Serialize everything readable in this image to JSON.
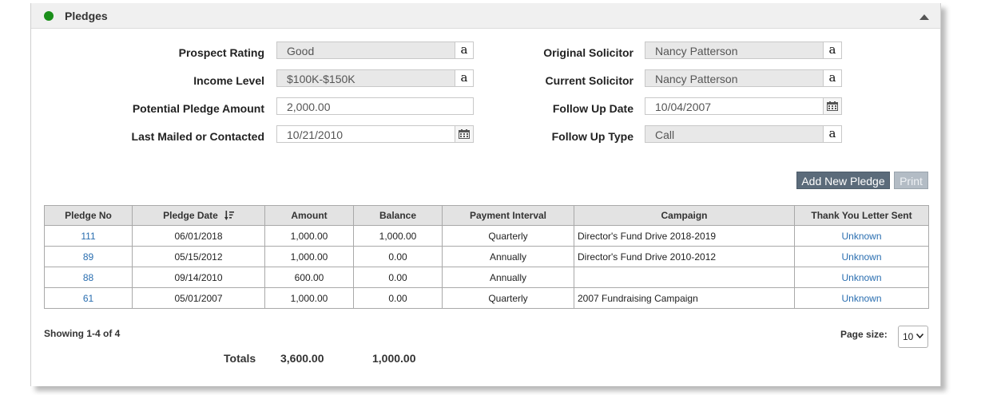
{
  "section": {
    "title": "Pledges",
    "status_color": "#1a8f1a"
  },
  "fields": {
    "prospect_rating": {
      "label": "Prospect Rating",
      "value": "Good"
    },
    "income_level": {
      "label": "Income Level",
      "value": "$100K-$150K"
    },
    "potential_pledge_amount": {
      "label": "Potential Pledge Amount",
      "value": "2,000.00"
    },
    "last_mailed": {
      "label": "Last Mailed or Contacted",
      "value": "10/21/2010"
    },
    "original_solicitor": {
      "label": "Original Solicitor",
      "value": "Nancy Patterson"
    },
    "current_solicitor": {
      "label": "Current Solicitor",
      "value": "Nancy Patterson"
    },
    "follow_up_date": {
      "label": "Follow Up Date",
      "value": "10/04/2007"
    },
    "follow_up_type": {
      "label": "Follow Up Type",
      "value": "Call"
    }
  },
  "lookup_button_label": "a",
  "toolbar": {
    "add_label": "Add New Pledge",
    "print_label": "Print"
  },
  "table": {
    "columns": [
      "Pledge No",
      "Pledge Date",
      "Amount",
      "Balance",
      "Payment Interval",
      "Campaign",
      "Thank You Letter Sent"
    ],
    "rows": [
      [
        "111",
        "06/01/2018",
        "1,000.00",
        "1,000.00",
        "Quarterly",
        "Director's Fund Drive 2018-2019",
        "Unknown"
      ],
      [
        "89",
        "05/15/2012",
        "1,000.00",
        "0.00",
        "Annually",
        "Director's Fund Drive 2010-2012",
        "Unknown"
      ],
      [
        "88",
        "09/14/2010",
        "600.00",
        "0.00",
        "Annually",
        "",
        "Unknown"
      ],
      [
        "61",
        "05/01/2007",
        "1,000.00",
        "0.00",
        "Quarterly",
        "2007 Fundraising Campaign",
        "Unknown"
      ]
    ]
  },
  "pagination": {
    "showing": "Showing 1-4 of 4",
    "page_size_label": "Page size:",
    "page_size": "10"
  },
  "totals": {
    "label": "Totals",
    "amount": "3,600.00",
    "balance": "1,000.00"
  },
  "icons": {
    "status": "status-dot-icon",
    "collapse": "caret-up-icon",
    "calendar": "calendar-icon",
    "sort": "sort-descending-icon",
    "select": "chevron-down-icon"
  },
  "colors": {
    "link": "#2a6eb0",
    "primary_button": "#5b6b7a",
    "disabled_button": "#b3bcc5",
    "readonly_field": "#e8e8e8"
  }
}
